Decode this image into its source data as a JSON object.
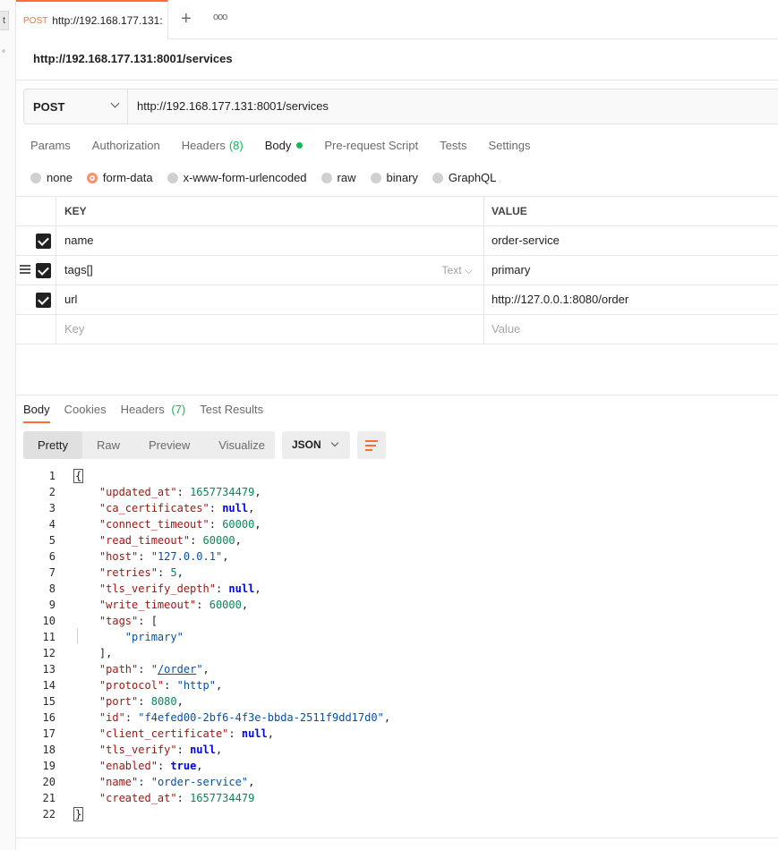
{
  "tab": {
    "method": "POST",
    "url": "http://192.168.177.131:"
  },
  "request": {
    "title": "http://192.168.177.131:8001/services",
    "method": "POST",
    "url": "http://192.168.177.131:8001/services",
    "tabs": [
      "Params",
      "Authorization",
      "Headers",
      "(8)",
      "Body",
      "Pre-request Script",
      "Tests",
      "Settings"
    ],
    "body_modes": [
      "none",
      "form-data",
      "x-www-form-urlencoded",
      "raw",
      "binary",
      "GraphQL"
    ],
    "selected_mode": "form-data"
  },
  "form": {
    "header_key": "KEY",
    "header_value": "VALUE",
    "rows": [
      {
        "key": "name",
        "value": "order-service"
      },
      {
        "key": "tags[]",
        "type": "Text",
        "value": "primary"
      },
      {
        "key": "url",
        "value": "http://127.0.0.1:8080/order"
      }
    ],
    "placeholder_key": "Key",
    "placeholder_value": "Value"
  },
  "response": {
    "tabs": [
      "Body",
      "Cookies",
      "Headers",
      "(7)",
      "Test Results"
    ],
    "views": [
      "Pretty",
      "Raw",
      "Preview",
      "Visualize"
    ],
    "format": "JSON",
    "lines": [
      {
        "n": "1",
        "parts": [
          {
            "t": "{",
            "c": "brace"
          }
        ]
      },
      {
        "n": "2",
        "parts": [
          {
            "t": "    "
          },
          {
            "t": "\"updated_at\"",
            "c": "key"
          },
          {
            "t": ": "
          },
          {
            "t": "1657734479",
            "c": "num"
          },
          {
            "t": ","
          }
        ]
      },
      {
        "n": "3",
        "parts": [
          {
            "t": "    "
          },
          {
            "t": "\"ca_certificates\"",
            "c": "key"
          },
          {
            "t": ": "
          },
          {
            "t": "null",
            "c": "kw"
          },
          {
            "t": ","
          }
        ]
      },
      {
        "n": "4",
        "parts": [
          {
            "t": "    "
          },
          {
            "t": "\"connect_timeout\"",
            "c": "key"
          },
          {
            "t": ": "
          },
          {
            "t": "60000",
            "c": "num"
          },
          {
            "t": ","
          }
        ]
      },
      {
        "n": "5",
        "parts": [
          {
            "t": "    "
          },
          {
            "t": "\"read_timeout\"",
            "c": "key"
          },
          {
            "t": ": "
          },
          {
            "t": "60000",
            "c": "num"
          },
          {
            "t": ","
          }
        ]
      },
      {
        "n": "6",
        "parts": [
          {
            "t": "    "
          },
          {
            "t": "\"host\"",
            "c": "key"
          },
          {
            "t": ": "
          },
          {
            "t": "\"127.0.0.1\"",
            "c": "str"
          },
          {
            "t": ","
          }
        ]
      },
      {
        "n": "7",
        "parts": [
          {
            "t": "    "
          },
          {
            "t": "\"retries\"",
            "c": "key"
          },
          {
            "t": ": "
          },
          {
            "t": "5",
            "c": "num"
          },
          {
            "t": ","
          }
        ]
      },
      {
        "n": "8",
        "parts": [
          {
            "t": "    "
          },
          {
            "t": "\"tls_verify_depth\"",
            "c": "key"
          },
          {
            "t": ": "
          },
          {
            "t": "null",
            "c": "kw"
          },
          {
            "t": ","
          }
        ]
      },
      {
        "n": "9",
        "parts": [
          {
            "t": "    "
          },
          {
            "t": "\"write_timeout\"",
            "c": "key"
          },
          {
            "t": ": "
          },
          {
            "t": "60000",
            "c": "num"
          },
          {
            "t": ","
          }
        ]
      },
      {
        "n": "10",
        "parts": [
          {
            "t": "    "
          },
          {
            "t": "\"tags\"",
            "c": "key"
          },
          {
            "t": ": ["
          }
        ]
      },
      {
        "n": "11",
        "parts": [
          {
            "t": "        "
          },
          {
            "t": "\"primary\"",
            "c": "str"
          }
        ]
      },
      {
        "n": "12",
        "parts": [
          {
            "t": "    ],"
          }
        ]
      },
      {
        "n": "13",
        "parts": [
          {
            "t": "    "
          },
          {
            "t": "\"path\"",
            "c": "key"
          },
          {
            "t": ": "
          },
          {
            "t": "\"",
            "c": "str"
          },
          {
            "t": "/order",
            "c": "str link"
          },
          {
            "t": "\"",
            "c": "str"
          },
          {
            "t": ","
          }
        ]
      },
      {
        "n": "14",
        "parts": [
          {
            "t": "    "
          },
          {
            "t": "\"protocol\"",
            "c": "key"
          },
          {
            "t": ": "
          },
          {
            "t": "\"http\"",
            "c": "str"
          },
          {
            "t": ","
          }
        ]
      },
      {
        "n": "15",
        "parts": [
          {
            "t": "    "
          },
          {
            "t": "\"port\"",
            "c": "key"
          },
          {
            "t": ": "
          },
          {
            "t": "8080",
            "c": "num"
          },
          {
            "t": ","
          }
        ]
      },
      {
        "n": "16",
        "parts": [
          {
            "t": "    "
          },
          {
            "t": "\"id\"",
            "c": "key"
          },
          {
            "t": ": "
          },
          {
            "t": "\"f4efed00-2bf6-4f3e-bbda-2511f9dd17d0\"",
            "c": "str"
          },
          {
            "t": ","
          }
        ]
      },
      {
        "n": "17",
        "parts": [
          {
            "t": "    "
          },
          {
            "t": "\"client_certificate\"",
            "c": "key"
          },
          {
            "t": ": "
          },
          {
            "t": "null",
            "c": "kw"
          },
          {
            "t": ","
          }
        ]
      },
      {
        "n": "18",
        "parts": [
          {
            "t": "    "
          },
          {
            "t": "\"tls_verify\"",
            "c": "key"
          },
          {
            "t": ": "
          },
          {
            "t": "null",
            "c": "kw"
          },
          {
            "t": ","
          }
        ]
      },
      {
        "n": "19",
        "parts": [
          {
            "t": "    "
          },
          {
            "t": "\"enabled\"",
            "c": "key"
          },
          {
            "t": ": "
          },
          {
            "t": "true",
            "c": "kw"
          },
          {
            "t": ","
          }
        ]
      },
      {
        "n": "20",
        "parts": [
          {
            "t": "    "
          },
          {
            "t": "\"name\"",
            "c": "key"
          },
          {
            "t": ": "
          },
          {
            "t": "\"order-service\"",
            "c": "str"
          },
          {
            "t": ","
          }
        ]
      },
      {
        "n": "21",
        "parts": [
          {
            "t": "    "
          },
          {
            "t": "\"created_at\"",
            "c": "key"
          },
          {
            "t": ": "
          },
          {
            "t": "1657734479",
            "c": "num"
          }
        ]
      },
      {
        "n": "22",
        "parts": [
          {
            "t": "}",
            "c": "brace"
          }
        ]
      }
    ]
  },
  "colors": {
    "accent": "#ff6c37",
    "success": "#0cbb52"
  },
  "icons": [
    "plus-icon",
    "more-icon",
    "chevron-down-icon",
    "drag-handle-icon",
    "checkbox-checked-icon",
    "wrap-lines-icon"
  ]
}
